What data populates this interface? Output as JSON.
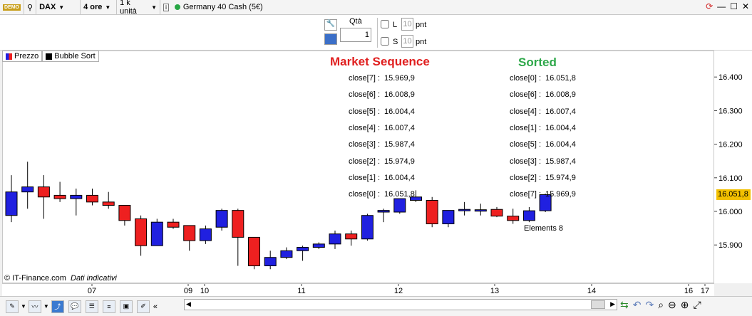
{
  "topbar": {
    "demo_label": "DEMO",
    "symbol": "DAX",
    "timeframe": "4 ore",
    "units": "1 k unità",
    "info_icon": "info-icon",
    "instrument": "Germany 40 Cash (5€)",
    "status_color": "#28a745"
  },
  "order": {
    "qty_label": "Qtà",
    "qty_value": "1",
    "long_label": "L",
    "long_value": "10",
    "short_label": "S",
    "short_value": "10",
    "unit": "pnt"
  },
  "legend": {
    "price": "Prezzo",
    "indicator": "Bubble Sort"
  },
  "sequence": {
    "title": "Market Sequence",
    "color": "#e02020",
    "rows": [
      {
        "key": "close[7] :",
        "val": "15.969,9"
      },
      {
        "key": "close[6] :",
        "val": "16.008,9"
      },
      {
        "key": "close[5] :",
        "val": "16.004,4"
      },
      {
        "key": "close[4] :",
        "val": "16.007,4"
      },
      {
        "key": "close[3] :",
        "val": "15.987,4"
      },
      {
        "key": "close[2] :",
        "val": "15.974,9"
      },
      {
        "key": "close[1] :",
        "val": "16.004,4"
      },
      {
        "key": "close[0] :",
        "val": "16.051,8"
      }
    ]
  },
  "sorted": {
    "title": "Sorted",
    "color": "#2ea84a",
    "rows": [
      {
        "key": "close[0] :",
        "val": "16.051,8"
      },
      {
        "key": "close[6] :",
        "val": "16.008,9"
      },
      {
        "key": "close[4] :",
        "val": "16.007,4"
      },
      {
        "key": "close[1] :",
        "val": "16.004,4"
      },
      {
        "key": "close[5] :",
        "val": "16.004,4"
      },
      {
        "key": "close[3] :",
        "val": "15.987,4"
      },
      {
        "key": "close[2] :",
        "val": "15.974,9"
      },
      {
        "key": "close[7] :",
        "val": "15.969,9"
      }
    ],
    "elements": "Elements 8"
  },
  "copyright": "© IT-Finance.com",
  "disclaimer": "Dati indicativi",
  "price_tag": "16.051,8",
  "chart_data": {
    "type": "candlestick",
    "y_ticks": [
      "16.400",
      "16.300",
      "16.200",
      "16.100",
      "16.000",
      "15.900"
    ],
    "x_ticks": [
      "07",
      "09",
      "10",
      "11",
      "12",
      "13",
      "14",
      "16",
      "17"
    ],
    "colors": {
      "up": "#2020e0",
      "down": "#ee2020"
    },
    "candles": [
      {
        "o": 15.99,
        "c": 16.06,
        "h": 16.11,
        "l": 15.97
      },
      {
        "o": 16.06,
        "c": 16.075,
        "h": 16.15,
        "l": 16.01
      },
      {
        "o": 16.075,
        "c": 16.045,
        "h": 16.11,
        "l": 15.98
      },
      {
        "o": 16.05,
        "c": 16.04,
        "h": 16.09,
        "l": 16.03
      },
      {
        "o": 16.04,
        "c": 16.05,
        "h": 16.07,
        "l": 15.99
      },
      {
        "o": 16.05,
        "c": 16.03,
        "h": 16.07,
        "l": 16.02
      },
      {
        "o": 16.03,
        "c": 16.02,
        "h": 16.06,
        "l": 16.01
      },
      {
        "o": 16.02,
        "c": 15.975,
        "h": 16.02,
        "l": 15.96
      },
      {
        "o": 15.98,
        "c": 15.9,
        "h": 15.99,
        "l": 15.87
      },
      {
        "o": 15.9,
        "c": 15.97,
        "h": 15.98,
        "l": 15.9
      },
      {
        "o": 15.97,
        "c": 15.955,
        "h": 15.98,
        "l": 15.95
      },
      {
        "o": 15.96,
        "c": 15.915,
        "h": 15.96,
        "l": 15.885
      },
      {
        "o": 15.915,
        "c": 15.95,
        "h": 15.96,
        "l": 15.905
      },
      {
        "o": 15.955,
        "c": 16.005,
        "h": 16.01,
        "l": 15.945
      },
      {
        "o": 16.005,
        "c": 15.925,
        "h": 16.01,
        "l": 15.84
      },
      {
        "o": 15.925,
        "c": 15.84,
        "h": 15.925,
        "l": 15.83
      },
      {
        "o": 15.84,
        "c": 15.865,
        "h": 15.885,
        "l": 15.83
      },
      {
        "o": 15.865,
        "c": 15.885,
        "h": 15.895,
        "l": 15.86
      },
      {
        "o": 15.885,
        "c": 15.895,
        "h": 15.9,
        "l": 15.855
      },
      {
        "o": 15.895,
        "c": 15.905,
        "h": 15.91,
        "l": 15.89
      },
      {
        "o": 15.905,
        "c": 15.935,
        "h": 15.945,
        "l": 15.89
      },
      {
        "o": 15.935,
        "c": 15.92,
        "h": 15.945,
        "l": 15.9
      },
      {
        "o": 15.92,
        "c": 15.99,
        "h": 15.995,
        "l": 15.915
      },
      {
        "o": 16.0,
        "c": 16.005,
        "h": 16.01,
        "l": 15.97
      },
      {
        "o": 16.0,
        "c": 16.04,
        "h": 16.04,
        "l": 15.995
      },
      {
        "o": 16.035,
        "c": 16.045,
        "h": 16.065,
        "l": 16.03
      },
      {
        "o": 16.035,
        "c": 15.965,
        "h": 16.045,
        "l": 15.955
      },
      {
        "o": 15.965,
        "c": 16.005,
        "h": 16.005,
        "l": 15.955
      },
      {
        "o": 16.005,
        "c": 16.008,
        "h": 16.03,
        "l": 15.99
      },
      {
        "o": 16.005,
        "c": 16.007,
        "h": 16.025,
        "l": 15.99
      },
      {
        "o": 16.008,
        "c": 15.988,
        "h": 16.015,
        "l": 15.985
      },
      {
        "o": 15.988,
        "c": 15.975,
        "h": 16.01,
        "l": 15.965
      },
      {
        "o": 15.975,
        "c": 16.004,
        "h": 16.015,
        "l": 15.97
      },
      {
        "o": 16.004,
        "c": 16.052,
        "h": 16.055,
        "l": 16.0
      }
    ]
  }
}
